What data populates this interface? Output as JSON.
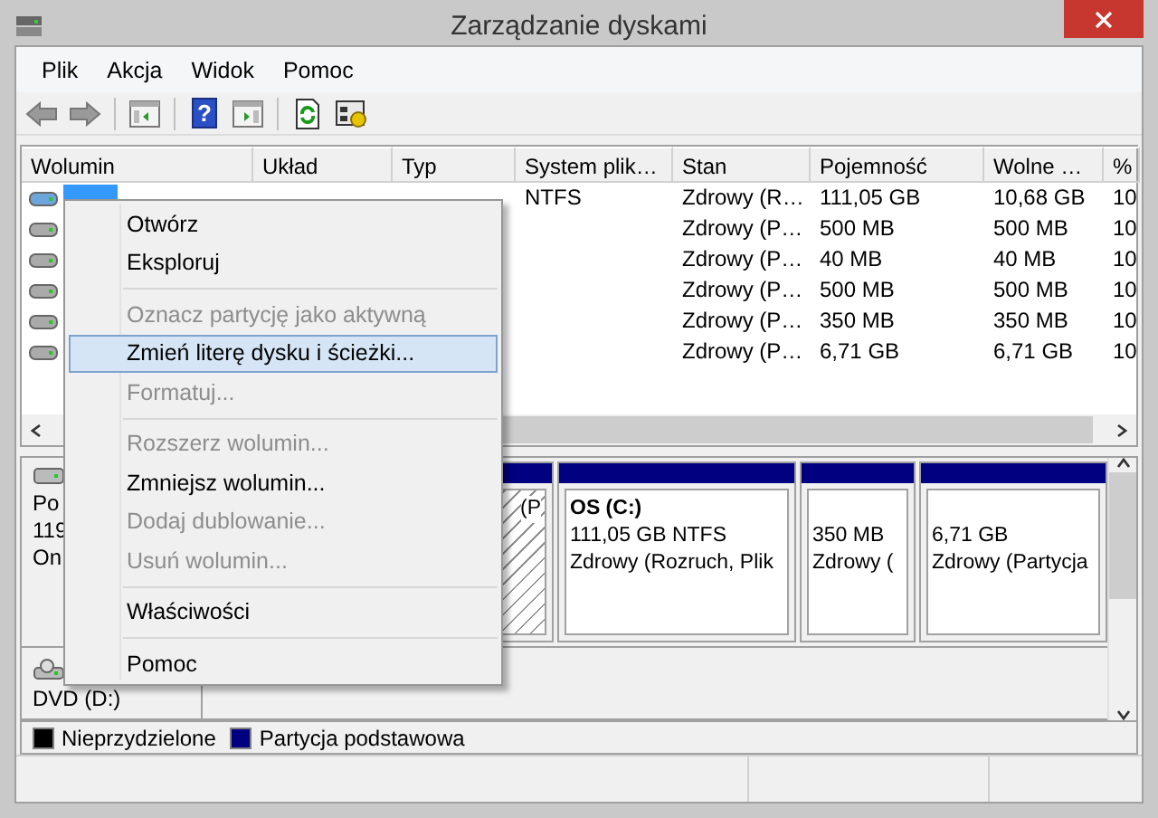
{
  "window": {
    "title": "Zarządzanie dyskami"
  },
  "menu_bar": [
    "Plik",
    "Akcja",
    "Widok",
    "Pomoc"
  ],
  "toolbar": {
    "help_glyph": "?"
  },
  "volume_table": {
    "columns": [
      "Wolumin",
      "Układ",
      "Typ",
      "System plik…",
      "Stan",
      "Pojemność",
      "Wolne …",
      "%"
    ],
    "rows": [
      {
        "selected": true,
        "file_system": "NTFS",
        "status": "Zdrowy (R…",
        "capacity": "111,05 GB",
        "free": "10,68 GB",
        "column_8": "10"
      },
      {
        "selected": false,
        "status": "Zdrowy (P…",
        "capacity": "500 MB",
        "free": "500 MB",
        "column_8": "10"
      },
      {
        "selected": false,
        "status": "Zdrowy (P…",
        "capacity": "40 MB",
        "free": "40 MB",
        "column_8": "10"
      },
      {
        "selected": false,
        "status": "Zdrowy (P…",
        "capacity": "500 MB",
        "free": "500 MB",
        "column_8": "10"
      },
      {
        "selected": false,
        "status": "Zdrowy (P…",
        "capacity": "350 MB",
        "free": "350 MB",
        "column_8": "10"
      },
      {
        "selected": false,
        "status": "Zdrowy (P…",
        "capacity": "6,71 GB",
        "free": "6,71 GB",
        "column_8": "10"
      }
    ]
  },
  "disks": [
    {
      "kind": "disk",
      "label_lines": [
        "Po",
        "119",
        "On"
      ],
      "partitions": [
        {
          "kind": "primary",
          "selected": true,
          "lines": [
            "(P"
          ]
        },
        {
          "kind": "primary",
          "selected": false,
          "title": "OS  (C:)",
          "lines": [
            "111,05 GB NTFS",
            "Zdrowy (Rozruch, Plik"
          ]
        },
        {
          "kind": "primary",
          "selected": false,
          "lines": [
            "350 MB",
            "Zdrowy ("
          ]
        },
        {
          "kind": "primary",
          "selected": false,
          "lines": [
            "6,71 GB",
            "Zdrowy (Partycja"
          ]
        }
      ]
    },
    {
      "kind": "cdrom",
      "label_lines": [
        "DVD (D:)"
      ]
    }
  ],
  "legend": [
    {
      "label": "Nieprzydzielone",
      "color": "#000000"
    },
    {
      "label": "Partycja podstawowa",
      "color": "#000080"
    }
  ],
  "context_menu": [
    {
      "kind": "item",
      "label": "Otwórz",
      "disabled": false,
      "selected": false
    },
    {
      "kind": "item",
      "label": "Eksploruj",
      "disabled": false,
      "selected": false
    },
    {
      "kind": "separator"
    },
    {
      "kind": "item",
      "label": "Oznacz partycję jako aktywną",
      "disabled": true,
      "selected": false
    },
    {
      "kind": "item",
      "label": "Zmień literę dysku i ścieżki...",
      "disabled": false,
      "selected": true
    },
    {
      "kind": "item",
      "label": "Formatuj...",
      "disabled": true,
      "selected": false
    },
    {
      "kind": "separator"
    },
    {
      "kind": "item",
      "label": "Rozszerz wolumin...",
      "disabled": true,
      "selected": false
    },
    {
      "kind": "item",
      "label": "Zmniejsz wolumin...",
      "disabled": false,
      "selected": false
    },
    {
      "kind": "item",
      "label": "Dodaj dublowanie...",
      "disabled": true,
      "selected": false
    },
    {
      "kind": "item",
      "label": "Usuń wolumin...",
      "disabled": true,
      "selected": false
    },
    {
      "kind": "separator"
    },
    {
      "kind": "item",
      "label": "Właściwości",
      "disabled": false,
      "selected": false
    },
    {
      "kind": "separator"
    },
    {
      "kind": "item",
      "label": "Pomoc",
      "disabled": false,
      "selected": false
    }
  ]
}
